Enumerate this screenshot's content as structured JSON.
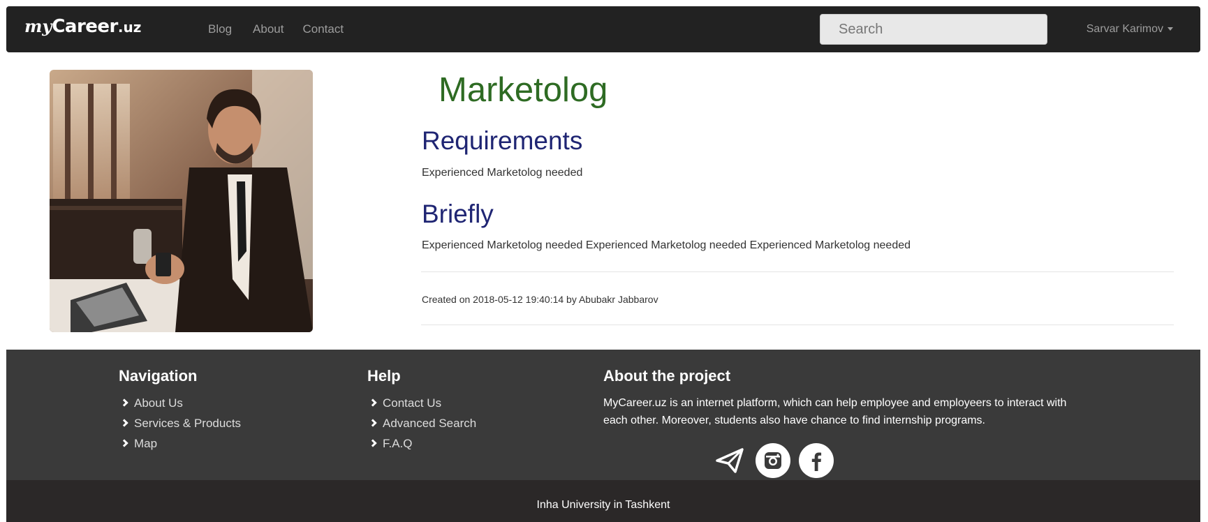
{
  "navbar": {
    "brand_script": "my",
    "brand_main": "Career",
    "brand_tld": ".uz",
    "links": [
      "Blog",
      "About",
      "Contact"
    ],
    "search_placeholder": "Search",
    "user_name": "Sarvar Karimov"
  },
  "job": {
    "title": "Marketolog",
    "requirements_heading": "Requirements",
    "requirements_text": "Experienced Marketolog needed",
    "briefly_heading": "Briefly",
    "briefly_text": "Experienced Marketolog needed Experienced Marketolog needed Experienced Marketolog needed",
    "meta": "Created on 2018-05-12 19:40:14 by Abubakr Jabbarov"
  },
  "footer": {
    "navigation": {
      "heading": "Navigation",
      "items": [
        "About Us",
        "Services & Products",
        "Map"
      ]
    },
    "help": {
      "heading": "Help",
      "items": [
        "Contact Us",
        "Advanced Search",
        "F.A.Q"
      ]
    },
    "about": {
      "heading": "About the project",
      "text": "MyCareer.uz is an internet platform, which can help employee and employeers to interact with each other. Moreover, students also have chance to find internship programs."
    },
    "socials": [
      "telegram-icon",
      "instagram-icon",
      "facebook-icon"
    ],
    "copyright": "Inha University in Tashkent"
  },
  "colors": {
    "navbar_bg": "#222222",
    "title_green": "#2e6b23",
    "heading_blue": "#1f2573",
    "footer_bg": "#3a3a3a",
    "bottom_bg": "#2b2828"
  }
}
